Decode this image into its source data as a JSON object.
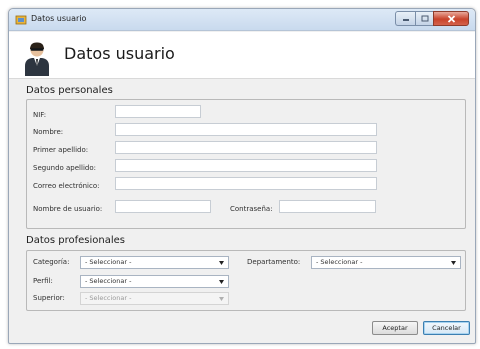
{
  "window": {
    "title": "Datos usuario"
  },
  "header": {
    "title": "Datos usuario"
  },
  "personal": {
    "section_title": "Datos personales",
    "nif_label": "NIF:",
    "nombre_label": "Nombre:",
    "primer_apellido_label": "Primer apellido:",
    "segundo_apellido_label": "Segundo apellido:",
    "correo_label": "Correo electrónico:",
    "usuario_label": "Nombre de usuario:",
    "contrasena_label": "Contraseña:"
  },
  "professional": {
    "section_title": "Datos profesionales",
    "categoria_label": "Categoría:",
    "categoria_value": "- Seleccionar -",
    "departamento_label": "Departamento:",
    "departamento_value": "- Seleccionar -",
    "perfil_label": "Perfil:",
    "perfil_value": "- Seleccionar -",
    "superior_label": "Superior:",
    "superior_value": "- Seleccionar -"
  },
  "footer": {
    "aceptar_label": "Aceptar",
    "cancelar_label": "Cancelar"
  },
  "colors": {
    "titlebar": "#c9daee",
    "close_button": "#c8432b",
    "primary_border": "#3c7fb1"
  },
  "icons": [
    "app-icon",
    "minimize-icon",
    "maximize-icon",
    "close-icon",
    "user-agent-icon",
    "dropdown-arrow-icon"
  ]
}
